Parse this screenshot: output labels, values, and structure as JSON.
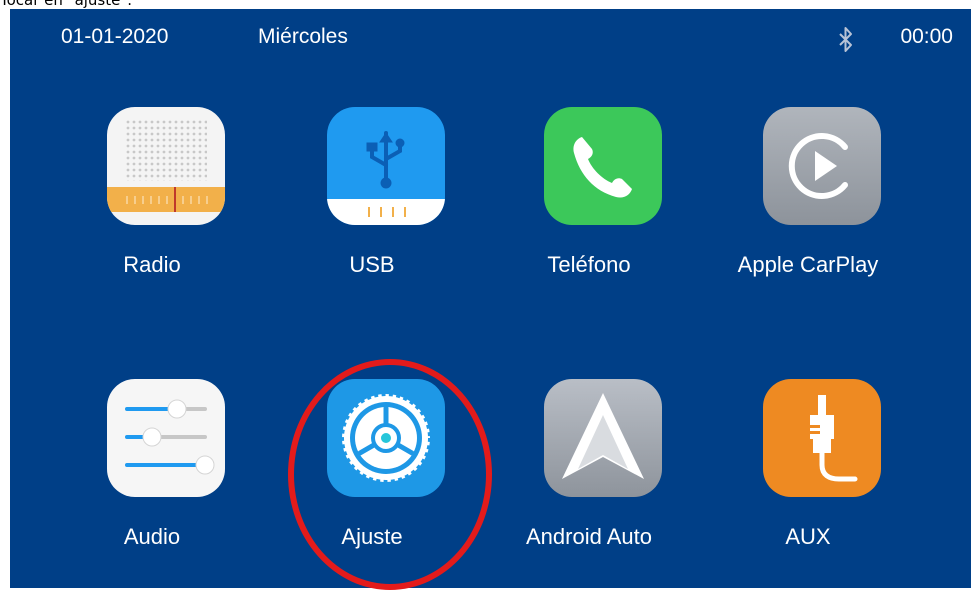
{
  "caption": "Tocar en \"ajuste\".",
  "status_bar": {
    "date": "01-01-2020",
    "weekday": "Miércoles",
    "bluetooth_icon": "bluetooth-icon",
    "time": "00:00"
  },
  "apps": [
    {
      "label": "Radio",
      "icon": "radio-icon"
    },
    {
      "label": "USB",
      "icon": "usb-icon"
    },
    {
      "label": "Teléfono",
      "icon": "phone-icon"
    },
    {
      "label": "Apple CarPlay",
      "icon": "carplay-icon"
    },
    {
      "label": "Audio",
      "icon": "audio-sliders-icon"
    },
    {
      "label": "Ajuste",
      "icon": "settings-gear-icon",
      "highlighted": true
    },
    {
      "label": "Android Auto",
      "icon": "android-auto-icon"
    },
    {
      "label": "AUX",
      "icon": "aux-cable-icon"
    }
  ],
  "colors": {
    "background": "#003f87",
    "highlight_ring": "#e31b1b",
    "text": "#ffffff"
  }
}
